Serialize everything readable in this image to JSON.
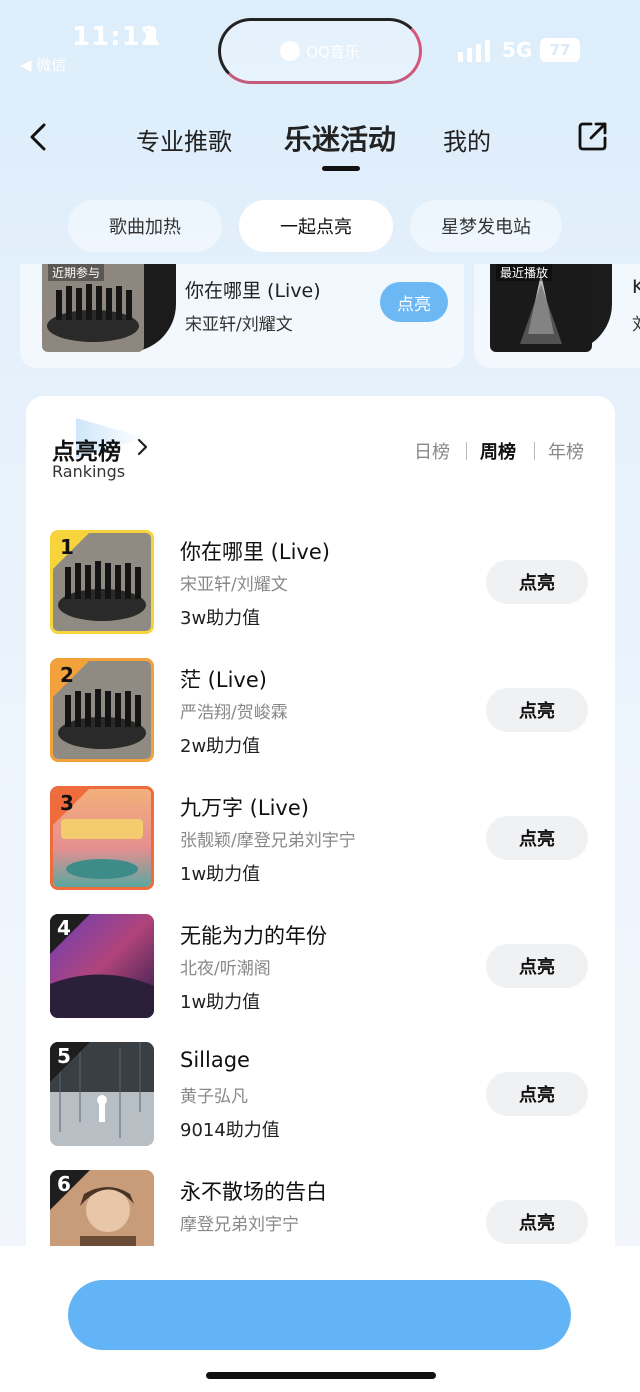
{
  "status": {
    "time": "11:12",
    "back_app": "◀ 微信",
    "island_text": "QQ音乐",
    "network": "5G",
    "battery": "77"
  },
  "nav": {
    "tabs": [
      {
        "label": "专业推歌"
      },
      {
        "label": "乐迷活动"
      },
      {
        "label": "我的"
      }
    ],
    "active_tab": "乐迷活动"
  },
  "pills": [
    {
      "label": "歌曲加热"
    },
    {
      "label": "一起点亮"
    },
    {
      "label": "星梦发电站"
    }
  ],
  "carousel": {
    "card1": {
      "tag": "近期参与",
      "title": "你在哪里 (Live)",
      "artist": "宋亚轩/刘耀文",
      "button": "点亮"
    },
    "card2": {
      "tag": "最近播放",
      "title": "K",
      "artist": "刘"
    }
  },
  "rankings": {
    "title": "点亮榜",
    "subtitle": "Rankings",
    "periods": [
      {
        "label": "日榜"
      },
      {
        "label": "周榜"
      },
      {
        "label": "年榜"
      }
    ],
    "active_period": "周榜",
    "items": [
      {
        "rank": "1",
        "title": "你在哪里 (Live)",
        "artist": "宋亚轩/刘耀文",
        "points": "3w助力值",
        "button": "点亮"
      },
      {
        "rank": "2",
        "title": "茫 (Live)",
        "artist": "严浩翔/贺峻霖",
        "points": "2w助力值",
        "button": "点亮"
      },
      {
        "rank": "3",
        "title": "九万字 (Live)",
        "artist": "张靓颖/摩登兄弟刘宇宁",
        "points": "1w助力值",
        "button": "点亮"
      },
      {
        "rank": "4",
        "title": "无能为力的年份",
        "artist": "北夜/听潮阁",
        "points": "1w助力值",
        "button": "点亮"
      },
      {
        "rank": "5",
        "title": "Sillage",
        "artist": "黄子弘凡",
        "points": "9014助力值",
        "button": "点亮"
      },
      {
        "rank": "6",
        "title": "永不散场的告白",
        "artist": "摩登兄弟刘宇宁",
        "points": "",
        "button": "点亮"
      }
    ]
  },
  "colors": {
    "accent": "#63b4f6",
    "rank1": "#f7d43b",
    "rank2": "#f3a13a",
    "rank3": "#ee6c3c"
  },
  "icons": {
    "back": "chevron-left-icon",
    "share": "share-icon",
    "mute": "bell-mute-icon"
  }
}
